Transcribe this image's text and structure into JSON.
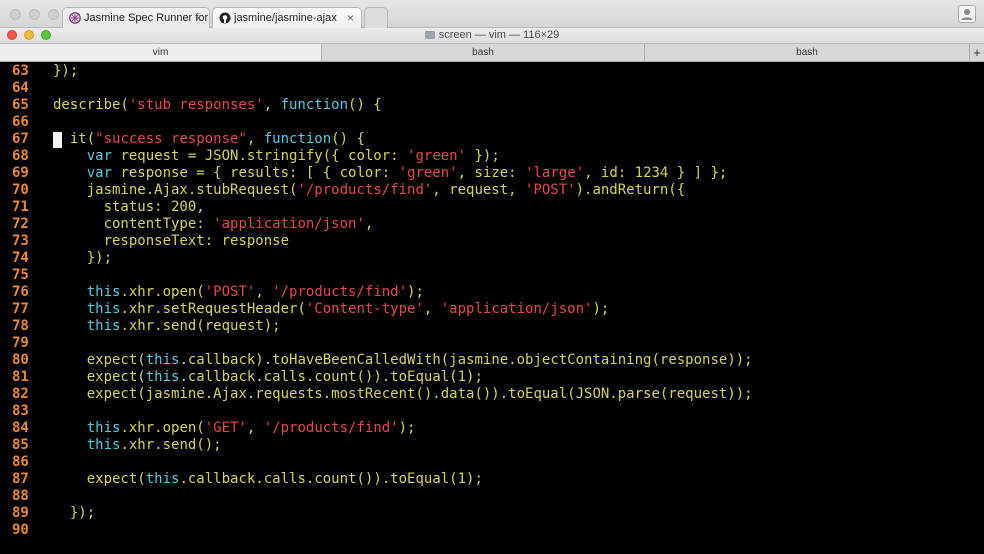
{
  "browser": {
    "tabs": [
      {
        "label": "Jasmine Spec Runner for t",
        "close": "×"
      },
      {
        "label": "jasmine/jasmine-ajax",
        "close": "×"
      }
    ]
  },
  "terminal": {
    "title": "screen — vim — 116×29",
    "tabs": [
      "vim",
      "bash",
      "bash"
    ],
    "new_tab": "+"
  },
  "colors": {
    "line_numbers": "#e48a35",
    "strings": "#e2484c",
    "identifiers": "#d3d35f",
    "keywords": "#5cc8e0"
  },
  "editor": {
    "cursor_line": 67,
    "lines": [
      {
        "n": "63",
        "indent": "",
        "tokens": [
          [
            "def",
            "});"
          ]
        ]
      },
      {
        "n": "64",
        "indent": "",
        "tokens": []
      },
      {
        "n": "65",
        "indent": "",
        "tokens": [
          [
            "def",
            "describe("
          ],
          [
            "str",
            "'stub responses'"
          ],
          [
            "def",
            ", "
          ],
          [
            "fn",
            "function"
          ],
          [
            "def",
            "() {"
          ]
        ]
      },
      {
        "n": "66",
        "indent": "",
        "tokens": []
      },
      {
        "n": "67",
        "indent": "  ",
        "tokens": [
          [
            "def",
            "it("
          ],
          [
            "str",
            "\"success response\""
          ],
          [
            "def",
            ", "
          ],
          [
            "fn",
            "function"
          ],
          [
            "def",
            "() {"
          ]
        ]
      },
      {
        "n": "68",
        "indent": "    ",
        "tokens": [
          [
            "key",
            "var"
          ],
          [
            "def",
            " request = JSON.stringify({ color: "
          ],
          [
            "str",
            "'green'"
          ],
          [
            "def",
            " });"
          ]
        ]
      },
      {
        "n": "69",
        "indent": "    ",
        "tokens": [
          [
            "key",
            "var"
          ],
          [
            "def",
            " response = { results: [ { color: "
          ],
          [
            "str",
            "'green'"
          ],
          [
            "def",
            ", size: "
          ],
          [
            "str",
            "'large'"
          ],
          [
            "def",
            ", id: 1234 } ] };"
          ]
        ]
      },
      {
        "n": "70",
        "indent": "    ",
        "tokens": [
          [
            "def",
            "jasmine.Ajax.stubRequest("
          ],
          [
            "str",
            "'/products/find'"
          ],
          [
            "def",
            ", request, "
          ],
          [
            "str",
            "'POST'"
          ],
          [
            "def",
            ").andReturn({"
          ]
        ]
      },
      {
        "n": "71",
        "indent": "      ",
        "tokens": [
          [
            "def",
            "status: 200,"
          ]
        ]
      },
      {
        "n": "72",
        "indent": "      ",
        "tokens": [
          [
            "def",
            "contentType: "
          ],
          [
            "str",
            "'application/json'"
          ],
          [
            "def",
            ","
          ]
        ]
      },
      {
        "n": "73",
        "indent": "      ",
        "tokens": [
          [
            "def",
            "responseText: response"
          ]
        ]
      },
      {
        "n": "74",
        "indent": "    ",
        "tokens": [
          [
            "def",
            "});"
          ]
        ]
      },
      {
        "n": "75",
        "indent": "",
        "tokens": []
      },
      {
        "n": "76",
        "indent": "    ",
        "tokens": [
          [
            "key",
            "this"
          ],
          [
            "def",
            ".xhr.open("
          ],
          [
            "str",
            "'POST'"
          ],
          [
            "def",
            ", "
          ],
          [
            "str",
            "'/products/find'"
          ],
          [
            "def",
            ");"
          ]
        ]
      },
      {
        "n": "77",
        "indent": "    ",
        "tokens": [
          [
            "key",
            "this"
          ],
          [
            "def",
            ".xhr.setRequestHeader("
          ],
          [
            "str",
            "'Content-type'"
          ],
          [
            "def",
            ", "
          ],
          [
            "str",
            "'application/json'"
          ],
          [
            "def",
            ");"
          ]
        ]
      },
      {
        "n": "78",
        "indent": "    ",
        "tokens": [
          [
            "key",
            "this"
          ],
          [
            "def",
            ".xhr.send(request);"
          ]
        ]
      },
      {
        "n": "79",
        "indent": "",
        "tokens": []
      },
      {
        "n": "80",
        "indent": "    ",
        "tokens": [
          [
            "def",
            "expect("
          ],
          [
            "key",
            "this"
          ],
          [
            "def",
            ".callback).toHaveBeenCalledWith(jasmine.objectContaining(response));"
          ]
        ]
      },
      {
        "n": "81",
        "indent": "    ",
        "tokens": [
          [
            "def",
            "expect("
          ],
          [
            "key",
            "this"
          ],
          [
            "def",
            ".callback.calls.count()).toEqual(1);"
          ]
        ]
      },
      {
        "n": "82",
        "indent": "    ",
        "tokens": [
          [
            "def",
            "expect(jasmine.Ajax.requests.mostRecent().data()).toEqual(JSON.parse(request));"
          ]
        ]
      },
      {
        "n": "83",
        "indent": "",
        "tokens": []
      },
      {
        "n": "84",
        "indent": "    ",
        "tokens": [
          [
            "key",
            "this"
          ],
          [
            "def",
            ".xhr.open("
          ],
          [
            "str",
            "'GET'"
          ],
          [
            "def",
            ", "
          ],
          [
            "str",
            "'/products/find'"
          ],
          [
            "def",
            ");"
          ]
        ]
      },
      {
        "n": "85",
        "indent": "    ",
        "tokens": [
          [
            "key",
            "this"
          ],
          [
            "def",
            ".xhr.send();"
          ]
        ]
      },
      {
        "n": "86",
        "indent": "",
        "tokens": []
      },
      {
        "n": "87",
        "indent": "    ",
        "tokens": [
          [
            "def",
            "expect("
          ],
          [
            "key",
            "this"
          ],
          [
            "def",
            ".callback.calls.count()).toEqual(1);"
          ]
        ]
      },
      {
        "n": "88",
        "indent": "",
        "tokens": []
      },
      {
        "n": "89",
        "indent": "  ",
        "tokens": [
          [
            "def",
            "});"
          ]
        ]
      },
      {
        "n": "90",
        "indent": "",
        "tokens": []
      }
    ]
  }
}
